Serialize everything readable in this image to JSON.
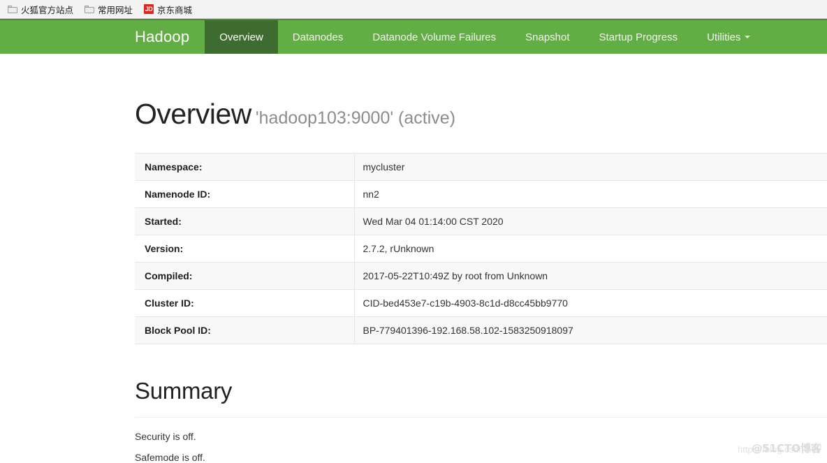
{
  "browser": {
    "bookmarks": [
      {
        "label": "火狐官方站点",
        "icon": "folder-icon"
      },
      {
        "label": "常用网址",
        "icon": "folder-icon"
      },
      {
        "label": "京东商城",
        "icon": "jd-icon",
        "icon_text": "JD"
      }
    ]
  },
  "navbar": {
    "brand": "Hadoop",
    "accent_color": "#63ad45",
    "active_color": "#3e6c30",
    "items": [
      {
        "label": "Overview",
        "active": true
      },
      {
        "label": "Datanodes",
        "active": false
      },
      {
        "label": "Datanode Volume Failures",
        "active": false
      },
      {
        "label": "Snapshot",
        "active": false
      },
      {
        "label": "Startup Progress",
        "active": false
      },
      {
        "label": "Utilities",
        "active": false,
        "has_caret": true
      }
    ]
  },
  "overview": {
    "title": "Overview",
    "subject": "'hadoop103:9000' (active)",
    "rows": [
      {
        "label": "Namespace:",
        "value": "mycluster"
      },
      {
        "label": "Namenode ID:",
        "value": "nn2"
      },
      {
        "label": "Started:",
        "value": "Wed Mar 04 01:14:00 CST 2020"
      },
      {
        "label": "Version:",
        "value": "2.7.2, rUnknown"
      },
      {
        "label": "Compiled:",
        "value": "2017-05-22T10:49Z by root from Unknown"
      },
      {
        "label": "Cluster ID:",
        "value": "CID-bed453e7-c19b-4903-8c1d-d8cc45bb9770"
      },
      {
        "label": "Block Pool ID:",
        "value": "BP-779401396-192.168.58.102-1583250918097"
      }
    ]
  },
  "summary": {
    "title": "Summary",
    "lines": [
      "Security is off.",
      "Safemode is off."
    ]
  },
  "watermarks": {
    "url": "https://blog.csdn.net/",
    "handle": "@51CTO博客"
  }
}
